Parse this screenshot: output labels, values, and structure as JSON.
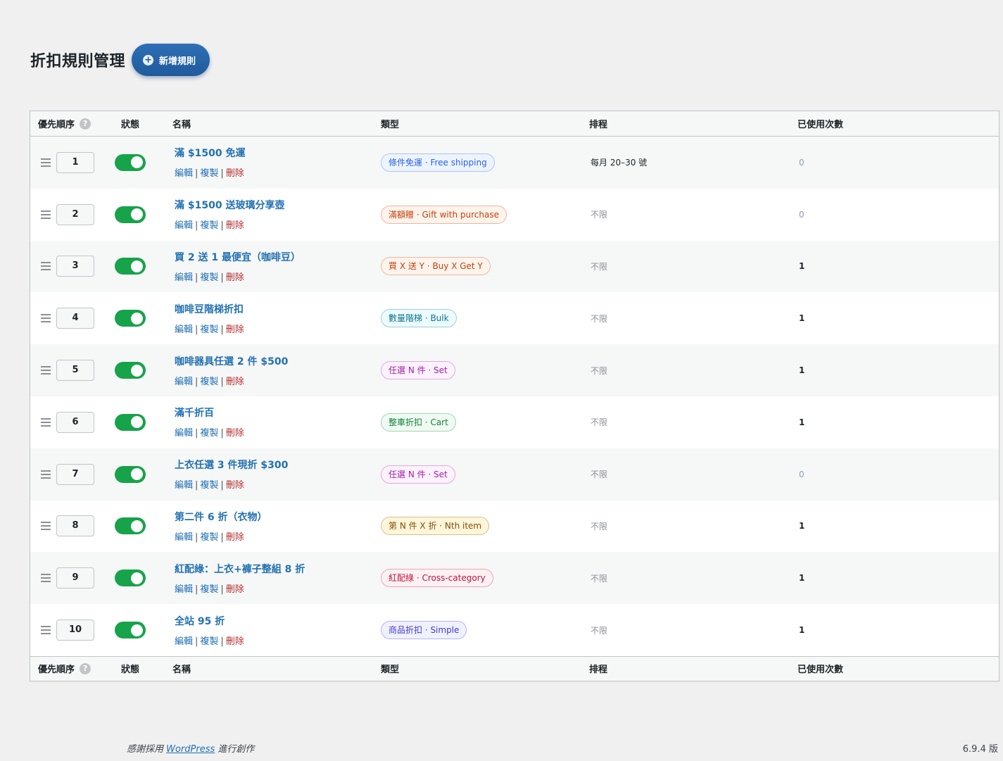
{
  "header": {
    "title": "折扣規則管理",
    "add_button": "新增規則",
    "add_icon": "plus-circle-icon"
  },
  "table": {
    "columns": {
      "priority": "優先順序",
      "status": "狀態",
      "name": "名稱",
      "type": "類型",
      "schedule": "排程",
      "used": "已使用次數"
    },
    "help_glyph": "?",
    "actions": {
      "edit": "編輯",
      "copy": "複製",
      "delete": "刪除",
      "separator": "|"
    },
    "rows": [
      {
        "priority": "1",
        "enabled": true,
        "name": "滿 $1500 免運",
        "type": "條件免運 · Free shipping",
        "type_color": "#2563eb",
        "type_bg": "#eef4ff",
        "schedule": "每月 20–30 號",
        "schedule_set": true,
        "used": "0"
      },
      {
        "priority": "2",
        "enabled": true,
        "name": "滿 $1500 送玻璃分享壺",
        "type": "滿額贈 · Gift with purchase",
        "type_color": "#c2410c",
        "type_bg": "#fff4ec",
        "schedule": "不限",
        "schedule_set": false,
        "used": "0"
      },
      {
        "priority": "3",
        "enabled": true,
        "name": "買 2 送 1 最便宜（咖啡豆）",
        "type": "買 X 送 Y · Buy X Get Y",
        "type_color": "#c2410c",
        "type_bg": "#fff4ec",
        "schedule": "不限",
        "schedule_set": false,
        "used": "1"
      },
      {
        "priority": "4",
        "enabled": true,
        "name": "咖啡豆階梯折扣",
        "type": "數量階梯 · Bulk",
        "type_color": "#0e7490",
        "type_bg": "#ecfbfd",
        "schedule": "不限",
        "schedule_set": false,
        "used": "1"
      },
      {
        "priority": "5",
        "enabled": true,
        "name": "咖啡器具任選 2 件 $500",
        "type": "任選 N 件 · Set",
        "type_color": "#a21caf",
        "type_bg": "#fdf2fd",
        "schedule": "不限",
        "schedule_set": false,
        "used": "1"
      },
      {
        "priority": "6",
        "enabled": true,
        "name": "滿千折百",
        "type": "整車折扣 · Cart",
        "type_color": "#15803d",
        "type_bg": "#effbf2",
        "schedule": "不限",
        "schedule_set": false,
        "used": "1"
      },
      {
        "priority": "7",
        "enabled": true,
        "name": "上衣任選 3 件現折 $300",
        "type": "任選 N 件 · Set",
        "type_color": "#a21caf",
        "type_bg": "#fdf2fd",
        "schedule": "不限",
        "schedule_set": false,
        "used": "0"
      },
      {
        "priority": "8",
        "enabled": true,
        "name": "第二件 6 折（衣物）",
        "type": "第 N 件 X 折 · Nth item",
        "type_color": "#854d0e",
        "type_bg": "#fef6d8",
        "schedule": "不限",
        "schedule_set": false,
        "used": "1"
      },
      {
        "priority": "9",
        "enabled": true,
        "name": "紅配綠：上衣+褲子整組 8 折",
        "type": "紅配綠 · Cross-category",
        "type_color": "#be123c",
        "type_bg": "#fff1f3",
        "schedule": "不限",
        "schedule_set": false,
        "used": "1"
      },
      {
        "priority": "10",
        "enabled": true,
        "name": "全站 95 折",
        "type": "商品折扣 · Simple",
        "type_color": "#4338ca",
        "type_bg": "#f0f1ff",
        "schedule": "不限",
        "schedule_set": false,
        "used": "1"
      }
    ]
  },
  "footer": {
    "thanks_prefix": "感謝採用 ",
    "thanks_link": "WordPress",
    "thanks_suffix": " 進行創作",
    "version": "6.9.4 版"
  }
}
